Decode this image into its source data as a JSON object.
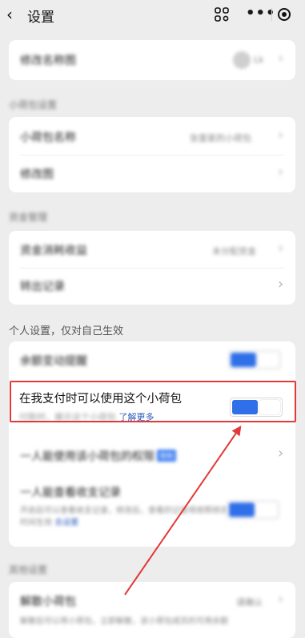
{
  "header": {
    "title": "设置",
    "more_glyph": "•••"
  },
  "cards": {
    "card1": {
      "label": "修改名称图",
      "value": "Lk"
    },
    "section1": "小荷包设置",
    "card2": [
      {
        "label": "小荷包名称",
        "value": "张雷家的小荷包"
      },
      {
        "label": "修改图",
        "value": ""
      }
    ],
    "section2": "资金管理",
    "card3": [
      {
        "label": "资金消耗收益",
        "value": "未分配资金"
      },
      {
        "label": "转出记录",
        "value": ""
      }
    ]
  },
  "personal": {
    "section_title": "个人设置，仅对自己生效",
    "row1": {
      "label": "余额变动提醒",
      "toggle_on": true
    },
    "row2": {
      "label": "在我支付时可以使用这个小荷包",
      "desc": "付款时，展示这个小荷包",
      "learn_more": "了解更多",
      "toggle_on": true
    },
    "row3": {
      "label": "一人能使用该小荷包的权限",
      "tag": "限制"
    },
    "row4": {
      "label": "一人能查看收支记录",
      "desc": "开启后可以查看收支记录，修改后，查看的记录将按照修改时间生效",
      "link": "去设置",
      "toggle_on": true
    }
  },
  "bottom": {
    "section_title": "其他设置",
    "row": {
      "label": "解散小荷包",
      "value": "请确认",
      "desc": "解散后可以将小荷包，立即解散，该小荷包成员的可用余额"
    }
  },
  "colors": {
    "accent": "#2f6fe8",
    "highlight": "#e23a3a",
    "background": "#ededed"
  }
}
